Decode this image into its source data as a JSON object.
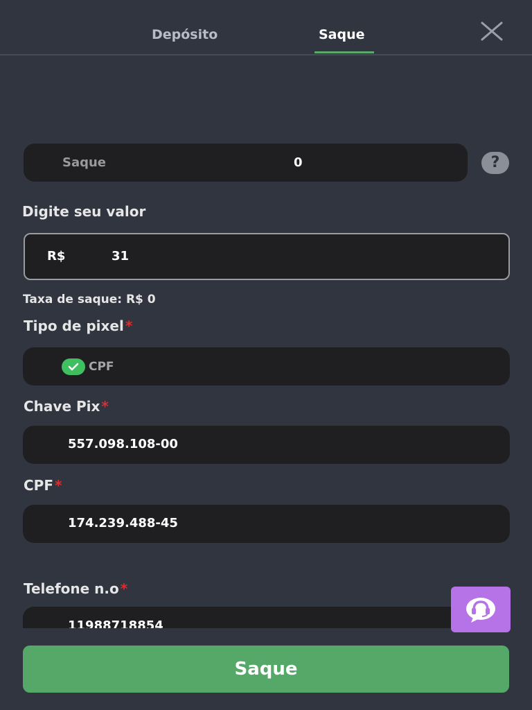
{
  "header": {
    "tabs": [
      {
        "label": "Depósito",
        "active": false
      },
      {
        "label": "Saque",
        "active": true
      }
    ],
    "close_icon": "close-icon"
  },
  "balance": {
    "label": "Saque",
    "value": "0",
    "help_icon": "?"
  },
  "amount": {
    "label": "Digite seu valor",
    "currency": "R$",
    "value": "31"
  },
  "fee": {
    "label": "Taxa de saque:",
    "value": "R$ 0"
  },
  "pix_type": {
    "label": "Tipo de pixel",
    "required_mark": "*",
    "selected": "CPF"
  },
  "pix_key": {
    "label": "Chave Pix",
    "required_mark": "*",
    "value": "557.098.108-00"
  },
  "cpf": {
    "label": "CPF",
    "required_mark": "*",
    "value": "174.239.488-45"
  },
  "phone": {
    "label": "Telefone n.o",
    "required_mark": "*",
    "value": "11988718854"
  },
  "submit": {
    "label": "Saque"
  },
  "colors": {
    "background": "#303540",
    "field": "#1f1f21",
    "accent_green": "#55a868",
    "support_purple": "#b673e8",
    "required_red": "#e22b2b"
  }
}
